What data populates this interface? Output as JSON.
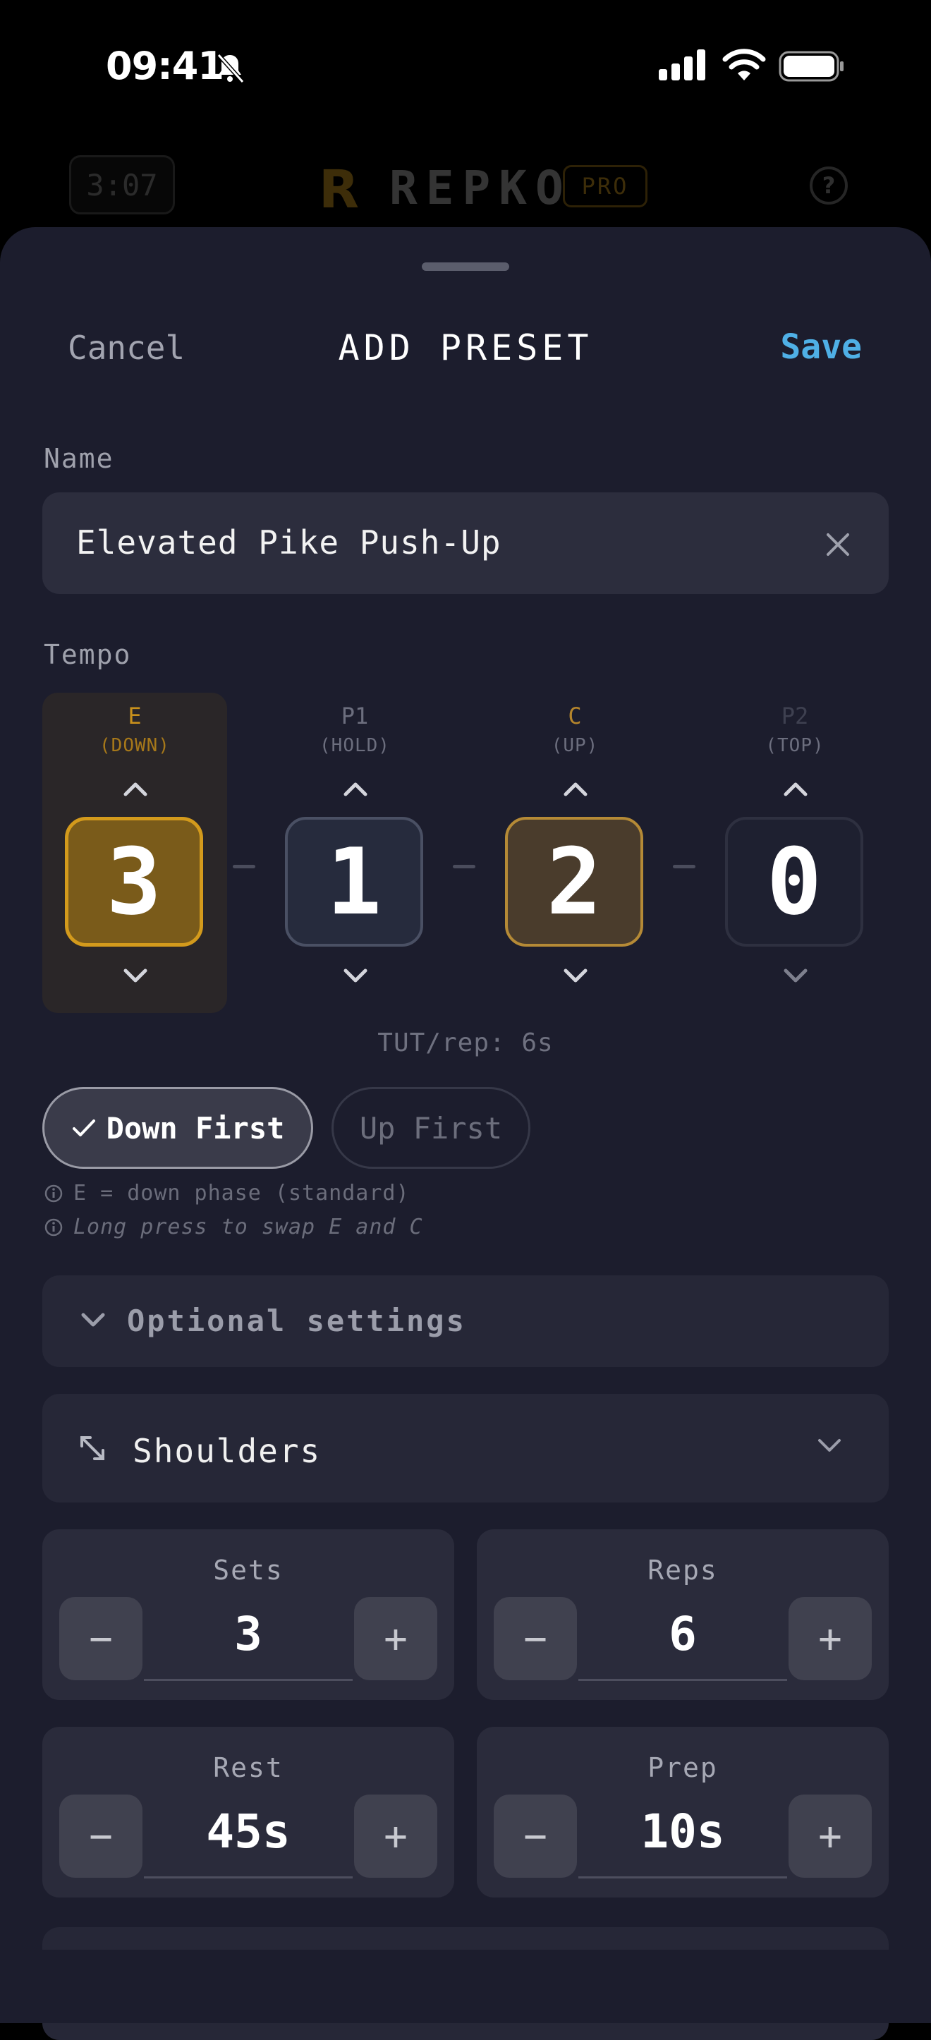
{
  "status_bar": {
    "time": "09:41",
    "icons": [
      "bell-slash-icon",
      "cellular-signal-icon",
      "wifi-icon",
      "battery-icon"
    ]
  },
  "background_app": {
    "timer": "3:07",
    "logo_letter": "R",
    "brand": "REPKO",
    "badge": "PRO",
    "help": "?"
  },
  "sheet": {
    "cancel_label": "Cancel",
    "title": "ADD PRESET",
    "save_label": "Save"
  },
  "name": {
    "label": "Name",
    "value": "Elevated Pike Push-Up",
    "clear_icon": "close-icon"
  },
  "tempo": {
    "label": "Tempo",
    "phases": [
      {
        "key": "E",
        "sub": "(DOWN)",
        "value": "3",
        "state": "active",
        "color": "#d39a1c"
      },
      {
        "key": "P1",
        "sub": "(HOLD)",
        "value": "1",
        "state": "normal",
        "color": "#4a5064"
      },
      {
        "key": "C",
        "sub": "(UP)",
        "value": "2",
        "state": "accent",
        "color": "#b58a36"
      },
      {
        "key": "P2",
        "sub": "(TOP)",
        "value": "0",
        "state": "dim",
        "color": "#2e3040"
      }
    ],
    "tut": "TUT/rep: 6s"
  },
  "direction": {
    "down_first_label": "Down First",
    "down_first_selected": true,
    "up_first_label": "Up First"
  },
  "info": {
    "line1": "E = down phase (standard)",
    "line2": "Long press to swap E and C"
  },
  "optional": {
    "label": "Optional settings"
  },
  "muscle": {
    "value": "Shoulders"
  },
  "steppers": {
    "sets": {
      "label": "Sets",
      "value": "3"
    },
    "reps": {
      "label": "Reps",
      "value": "6"
    },
    "rest": {
      "label": "Rest",
      "value": "45s"
    },
    "prep": {
      "label": "Prep",
      "value": "10s"
    },
    "minus": "−",
    "plus": "+"
  },
  "colors": {
    "accent_blue": "#4fb0e6",
    "accent_gold": "#d39a1c",
    "sheet_bg": "#1c1d2d"
  }
}
